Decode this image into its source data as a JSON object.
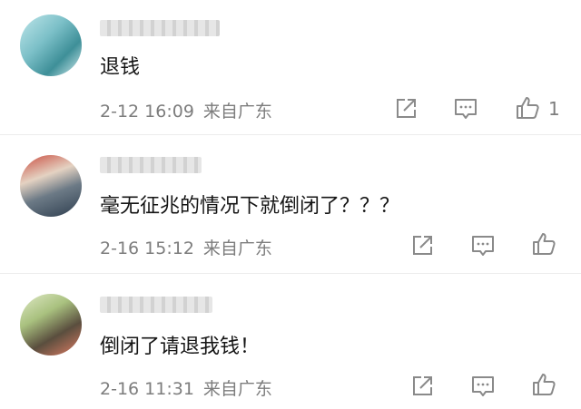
{
  "comments": [
    {
      "username": "",
      "text": "退钱",
      "date": "2-12 16:09",
      "location": "来自广东",
      "likes": "1",
      "icons": {
        "share": "share-icon",
        "reply": "comment-icon",
        "like": "thumbs-up-icon"
      }
    },
    {
      "username": "",
      "text": "毫无征兆的情况下就倒闭了？？？",
      "date": "2-16 15:12",
      "location": "来自广东",
      "likes": "",
      "icons": {
        "share": "share-icon",
        "reply": "comment-icon",
        "like": "thumbs-up-icon"
      }
    },
    {
      "username": "",
      "text": "倒闭了请退我钱！",
      "date": "2-16 11:31",
      "location": "来自广东",
      "likes": "",
      "icons": {
        "share": "share-icon",
        "reply": "comment-icon",
        "like": "thumbs-up-icon"
      }
    }
  ]
}
